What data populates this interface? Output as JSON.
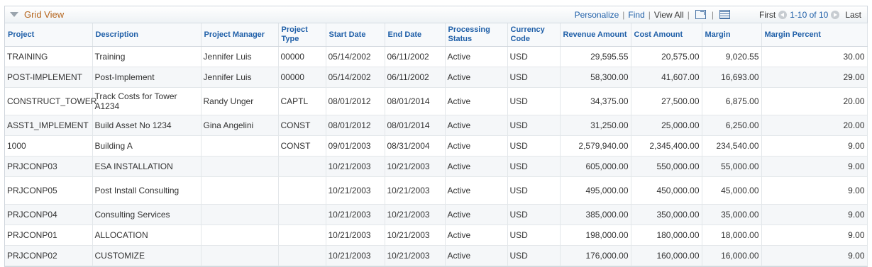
{
  "grid": {
    "title": "Grid View",
    "nav": {
      "personalize": "Personalize",
      "find": "Find",
      "view_all": "View All",
      "first": "First",
      "range": "1-10 of 10",
      "last": "Last"
    },
    "icons": {
      "collapse": "collapse-arrow-icon",
      "zoom": "zoom-icon",
      "download": "download-grid-icon",
      "prev": "previous-icon",
      "next": "next-icon"
    },
    "columns": [
      "Project",
      "Description",
      "Project Manager",
      "Project Type",
      "Start Date",
      "End Date",
      "Processing Status",
      "Currency Code",
      "Revenue Amount",
      "Cost Amount",
      "Margin",
      "Margin Percent"
    ],
    "rows": [
      {
        "project": "TRAINING",
        "description": "Training",
        "manager": "Jennifer Luis",
        "type": "00000",
        "start": "05/14/2002",
        "end": "06/11/2002",
        "status": "Active",
        "currency": "USD",
        "revenue": "29,595.55",
        "cost": "20,575.00",
        "margin": "9,020.55",
        "margin_pct": "30.00"
      },
      {
        "project": "POST-IMPLEMENT",
        "description": "Post-Implement",
        "manager": "Jennifer Luis",
        "type": "00000",
        "start": "05/14/2002",
        "end": "06/11/2002",
        "status": "Active",
        "currency": "USD",
        "revenue": "58,300.00",
        "cost": "41,607.00",
        "margin": "16,693.00",
        "margin_pct": "29.00"
      },
      {
        "project": "CONSTRUCT_TOWER",
        "description": "Track Costs for Tower A1234",
        "manager": "Randy Unger",
        "type": "CAPTL",
        "start": "08/01/2012",
        "end": "08/01/2014",
        "status": "Active",
        "currency": "USD",
        "revenue": "34,375.00",
        "cost": "27,500.00",
        "margin": "6,875.00",
        "margin_pct": "20.00"
      },
      {
        "project": "ASST1_IMPLEMENT",
        "description": "Build Asset No 1234",
        "manager": "Gina Angelini",
        "type": "CONST",
        "start": "08/01/2012",
        "end": "08/01/2014",
        "status": "Active",
        "currency": "USD",
        "revenue": "31,250.00",
        "cost": "25,000.00",
        "margin": "6,250.00",
        "margin_pct": "20.00"
      },
      {
        "project": "1000",
        "description": "Building A",
        "manager": "",
        "type": "CONST",
        "start": "09/01/2003",
        "end": "08/31/2004",
        "status": "Active",
        "currency": "USD",
        "revenue": "2,579,940.00",
        "cost": "2,345,400.00",
        "margin": "234,540.00",
        "margin_pct": "9.00"
      },
      {
        "project": "PRJCONP03",
        "description": "ESA INSTALLATION",
        "manager": "",
        "type": "",
        "start": "10/21/2003",
        "end": "10/21/2003",
        "status": "Active",
        "currency": "USD",
        "revenue": "605,000.00",
        "cost": "550,000.00",
        "margin": "55,000.00",
        "margin_pct": "9.00"
      },
      {
        "project": "PRJCONP05",
        "description": "Post Install Consulting",
        "manager": "",
        "type": "",
        "start": "10/21/2003",
        "end": "10/21/2003",
        "status": "Active",
        "currency": "USD",
        "revenue": "495,000.00",
        "cost": "450,000.00",
        "margin": "45,000.00",
        "margin_pct": "9.00"
      },
      {
        "project": "PRJCONP04",
        "description": "Consulting Services",
        "manager": "",
        "type": "",
        "start": "10/21/2003",
        "end": "10/21/2003",
        "status": "Active",
        "currency": "USD",
        "revenue": "385,000.00",
        "cost": "350,000.00",
        "margin": "35,000.00",
        "margin_pct": "9.00"
      },
      {
        "project": "PRJCONP01",
        "description": "ALLOCATION",
        "manager": "",
        "type": "",
        "start": "10/21/2003",
        "end": "10/21/2003",
        "status": "Active",
        "currency": "USD",
        "revenue": "198,000.00",
        "cost": "180,000.00",
        "margin": "18,000.00",
        "margin_pct": "9.00"
      },
      {
        "project": "PRJCONP02",
        "description": "CUSTOMIZE",
        "manager": "",
        "type": "",
        "start": "10/21/2003",
        "end": "10/21/2003",
        "status": "Active",
        "currency": "USD",
        "revenue": "176,000.00",
        "cost": "160,000.00",
        "margin": "16,000.00",
        "margin_pct": "9.00"
      }
    ]
  }
}
